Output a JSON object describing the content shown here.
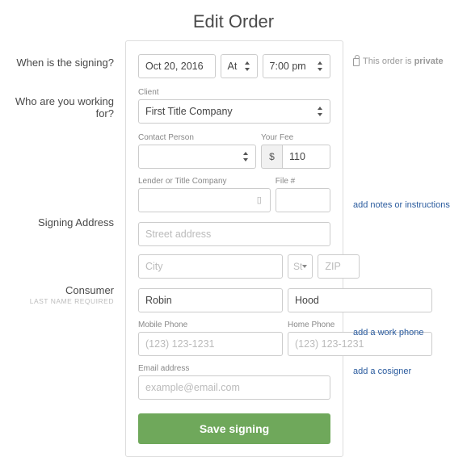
{
  "page_title": "Edit Order",
  "labels": {
    "when": "When is the signing?",
    "who": "Who are you working for?",
    "signing_address": "Signing Address",
    "consumer": "Consumer",
    "consumer_sub": "LAST NAME REQUIRED"
  },
  "signing": {
    "date": "Oct 20, 2016",
    "at_label": "At",
    "time": "7:00 pm"
  },
  "client": {
    "label": "Client",
    "value": "First Title Company"
  },
  "contact": {
    "label": "Contact Person",
    "value": ""
  },
  "fee": {
    "label": "Your Fee",
    "currency": "$",
    "value": "110"
  },
  "lender": {
    "label": "Lender or Title Company",
    "value": ""
  },
  "file": {
    "label": "File #",
    "value": ""
  },
  "address": {
    "street_placeholder": "Street address",
    "city_placeholder": "City",
    "state_placeholder": "St",
    "zip_placeholder": "ZIP"
  },
  "consumer": {
    "first": "Robin",
    "last": "Hood",
    "mobile_label": "Mobile Phone",
    "mobile_placeholder": "(123) 123-1231",
    "home_label": "Home Phone",
    "home_placeholder": "(123) 123-1231",
    "email_label": "Email address",
    "email_placeholder": "example@email.com"
  },
  "actions": {
    "save": "Save signing"
  },
  "side": {
    "private_prefix": "This order is ",
    "private_word": "private",
    "notes": "add notes or instructions",
    "work_phone": "add a work phone",
    "cosigner": "add a cosigner"
  }
}
